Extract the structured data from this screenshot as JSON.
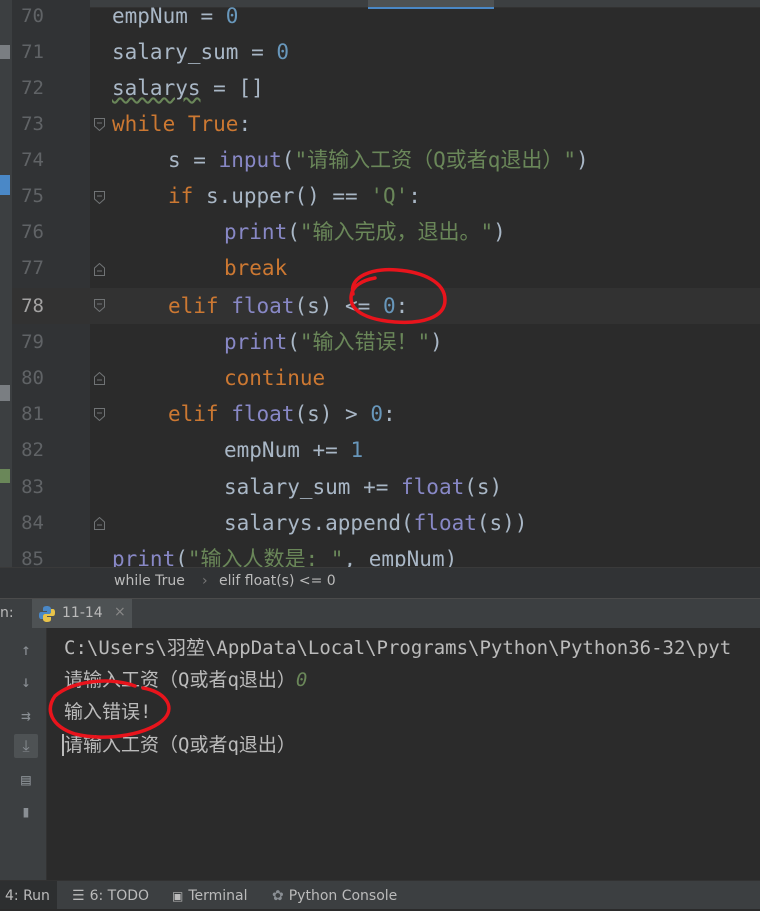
{
  "editor": {
    "lines": [
      {
        "n": "70",
        "text": "empNum = 0"
      },
      {
        "n": "71",
        "text": "salary_sum = 0"
      },
      {
        "n": "72",
        "text": "salarys = []"
      },
      {
        "n": "73",
        "text": "while True:"
      },
      {
        "n": "74",
        "text": "s = input(\"请输入工资（Q或者q退出）\")"
      },
      {
        "n": "75",
        "text": "if s.upper() == 'Q':"
      },
      {
        "n": "76",
        "text": "print(\"输入完成，退出。\")"
      },
      {
        "n": "77",
        "text": "break"
      },
      {
        "n": "78",
        "text": "elif float(s) <= 0:"
      },
      {
        "n": "79",
        "text": "print(\"输入错误！\")"
      },
      {
        "n": "80",
        "text": "continue"
      },
      {
        "n": "81",
        "text": "elif float(s) > 0:"
      },
      {
        "n": "82",
        "text": "empNum += 1"
      },
      {
        "n": "83",
        "text": "salary_sum += float(s)"
      },
      {
        "n": "84",
        "text": "salarys.append(float(s))"
      },
      {
        "n": "85",
        "text": "print(\"输入人数是: \", empNum)"
      }
    ],
    "current_line": "78"
  },
  "breadcrumb": {
    "items": [
      "while True",
      "elif float(s) <= 0"
    ],
    "separator": "›"
  },
  "run": {
    "panel_label": "n:",
    "tab_label": "11-14",
    "close_icon": "×",
    "console": {
      "path": "C:\\Users\\羽堃\\AppData\\Local\\Programs\\Python\\Python36-32\\pyt",
      "prompt1": "请输入工资（Q或者q退出）",
      "input1": "0",
      "error": "输入错误!",
      "prompt2": "请输入工资（Q或者q退出）"
    }
  },
  "bottombar": {
    "run": "4: Run",
    "todo": "6: TODO",
    "terminal": "Terminal",
    "python_console": "Python Console"
  },
  "colors": {
    "keyword": "#cc7832",
    "number": "#6897bb",
    "string": "#6a8759",
    "builtin": "#8888c6",
    "annotation": "#e8141c"
  }
}
